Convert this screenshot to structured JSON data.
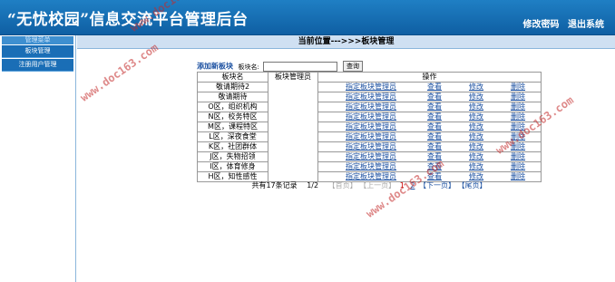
{
  "header": {
    "title": "“无忧校园”信息交流平台管理后台",
    "change_password": "修改密码",
    "logout": "退出系统"
  },
  "sidebar": {
    "heading": "管理菜单",
    "items": [
      {
        "label": "板块管理"
      },
      {
        "label": "注册用户管理"
      }
    ]
  },
  "main": {
    "location": "当前位置--->>>板块管理"
  },
  "toolbar": {
    "add_board": "添加新板块",
    "board_name_label": "板块名:",
    "board_name_value": "",
    "search_button": "查询"
  },
  "table": {
    "headers": {
      "name": "板块名",
      "admin": "板块管理员",
      "ops": "操作"
    },
    "op_labels": {
      "assign": "指定板块管理员",
      "view": "查看",
      "edit": "修改",
      "delete": "删除"
    },
    "rows": [
      {
        "name": "敬请期待2",
        "admin": ""
      },
      {
        "name": "敬请期待",
        "admin": ""
      },
      {
        "name": "O区，组织机构",
        "admin": ""
      },
      {
        "name": "N区，校务特区",
        "admin": ""
      },
      {
        "name": "M区，课程特区",
        "admin": ""
      },
      {
        "name": "L区，深夜食堂",
        "admin": ""
      },
      {
        "name": "K区，社团群体",
        "admin": ""
      },
      {
        "name": "J区，失物招领",
        "admin": ""
      },
      {
        "name": "I区，体育修身",
        "admin": ""
      },
      {
        "name": "H区，知性感性",
        "admin": ""
      }
    ]
  },
  "pager": {
    "total": "共有17条记录",
    "page_of": "1/2",
    "first": "【首页】",
    "prev": "【上一页】",
    "page1": "1",
    "page2": "2",
    "next": "【下一页】",
    "last": "【尾页】"
  },
  "watermark": "www.doc163.com",
  "colors": {
    "header_blue": "#1a6eb6",
    "link_blue": "#1a4fa0",
    "watermark_red": "#c42a2a"
  }
}
